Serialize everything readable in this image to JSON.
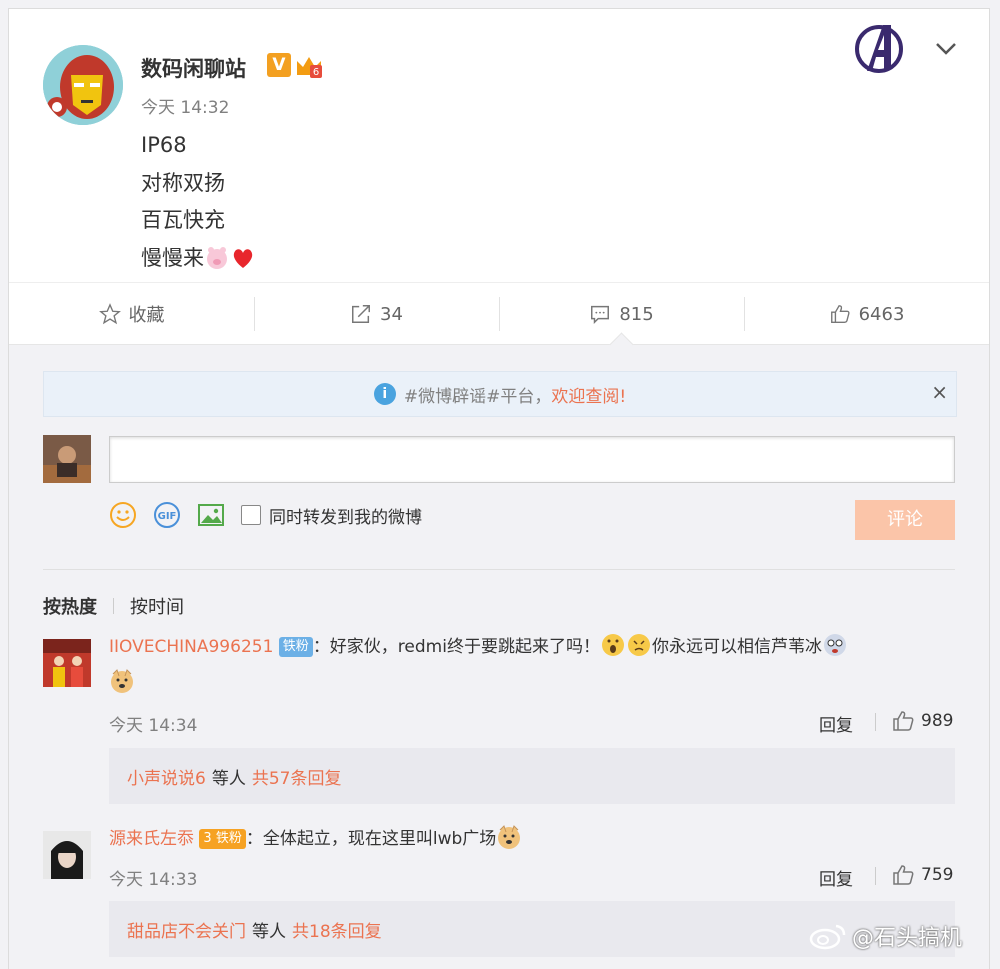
{
  "post": {
    "username": "数码闲聊站",
    "verified_badge": "V",
    "member_badge_level": "6",
    "time": "今天 14:32",
    "lines": [
      "IP68",
      "对称双扬",
      "百瓦快充",
      "慢慢来"
    ],
    "avatar_icon": "iron-man-avatar"
  },
  "actions": {
    "favorite_label": "收藏",
    "repost_count": "34",
    "comment_count": "815",
    "like_count": "6463"
  },
  "notice": {
    "text_gray": "#微博辟谣#平台，",
    "text_highlight": "欢迎查阅!",
    "close": "×"
  },
  "composer": {
    "repost_label": "同时转发到我的微博",
    "submit_label": "评论"
  },
  "sort": {
    "hot": "按热度",
    "time": "按时间"
  },
  "comments": [
    {
      "name": "IIOVECHINA996251",
      "fan_badge": "铁粉",
      "text": "：好家伙，redmi终于要跳起来了吗！",
      "text2": "你永远可以相信芦苇冰",
      "time": "今天 14:34",
      "reply": "回复",
      "likes": "989",
      "sub_user": "小声说说6",
      "sub_mid": "等人",
      "sub_count": "共57条回复"
    },
    {
      "name": "源来氏左忝",
      "fan_badge": "铁粉",
      "fan_level": "3",
      "text": "：全体起立，现在这里叫lwb广场",
      "time": "今天 14:33",
      "reply": "回复",
      "likes": "759",
      "sub_user": "甜品店不会关门",
      "sub_mid": "等人",
      "sub_count": "共18条回复"
    }
  ],
  "watermark": "@石头搞机",
  "colors": {
    "accent": "#eb7350",
    "submit_disabled": "#fbc5a9",
    "fan_badge": "#6cb0e6",
    "notice_bg": "#eaf1f9"
  }
}
